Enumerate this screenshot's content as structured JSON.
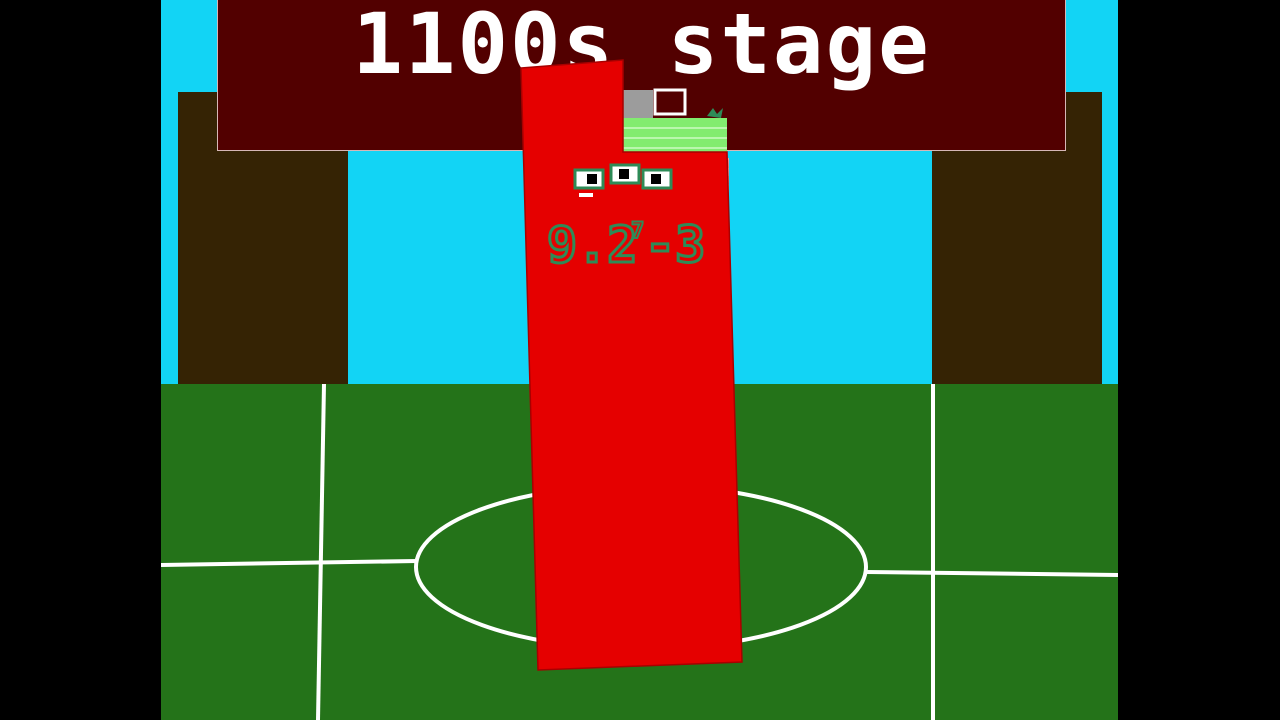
{
  "stage_title": "1100s stage",
  "character": {
    "label": "9.2⁷-3",
    "label_parts": {
      "main": "9.2",
      "exponent": "7",
      "tail": "-3"
    },
    "color": "#e50000"
  },
  "colors": {
    "sky": "#12d4f5",
    "grass": "#247319",
    "wall": "#352304",
    "banner": "#520000",
    "banner_text": "#ffffff",
    "field_lines": "#ffffff",
    "character_red": "#e50000",
    "label_green": "#2e8b57"
  }
}
